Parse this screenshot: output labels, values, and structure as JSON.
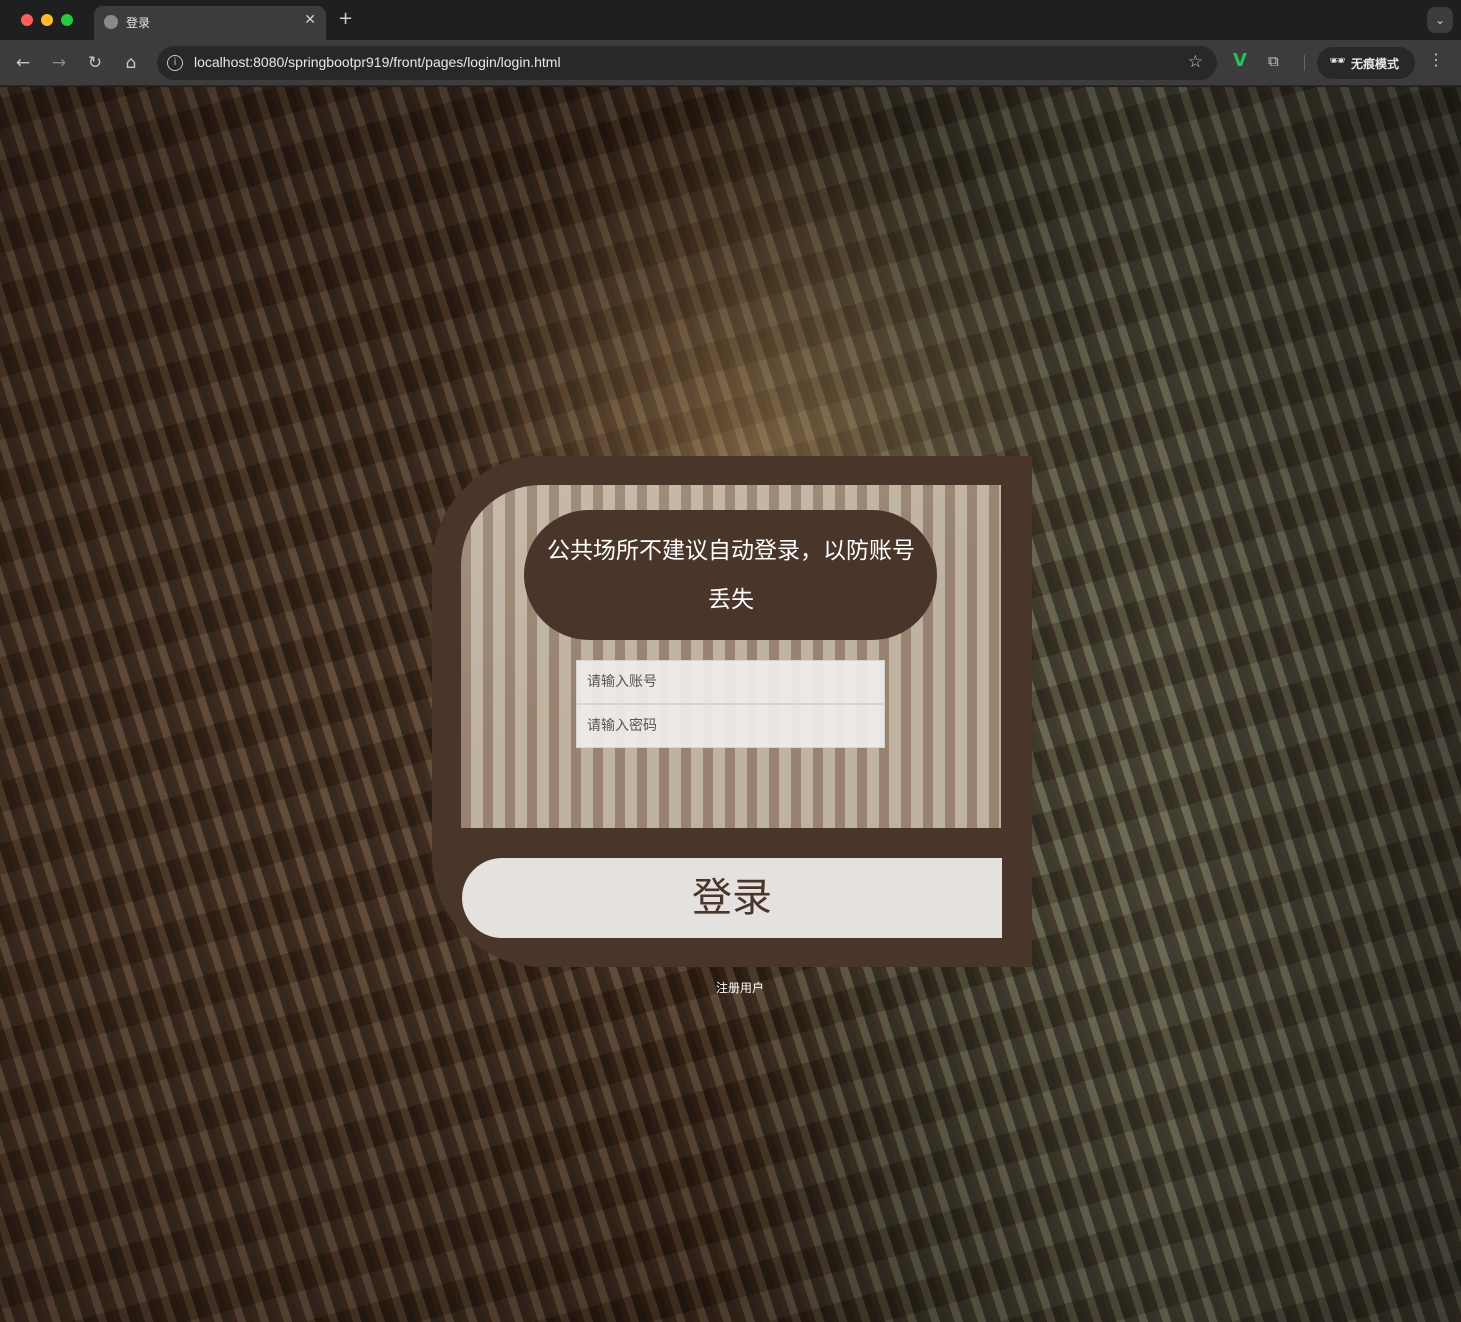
{
  "browser": {
    "tab_title": "登录",
    "url": "localhost:8080/springbootpr919/front/pages/login/login.html",
    "incognito_label": "无痕模式",
    "icons": {
      "back": "arrow-left-icon",
      "forward": "arrow-right-icon",
      "reload": "reload-icon",
      "home": "home-icon",
      "info": "info-icon",
      "bookmark": "star-icon",
      "extension_v": "vue-extension-icon",
      "extensions": "puzzle-icon",
      "incognito": "incognito-icon",
      "menu": "kebab-menu-icon"
    }
  },
  "login": {
    "notice": "公共场所不建议自动登录，以防账号丢失",
    "account_placeholder": "请输入账号",
    "password_placeholder": "请输入密码",
    "login_button": "登录",
    "register_link": "注册用户"
  },
  "colors": {
    "card_brown": "#4a352a",
    "button_bg": "#ebe8e6",
    "text_white": "#ffffff"
  }
}
